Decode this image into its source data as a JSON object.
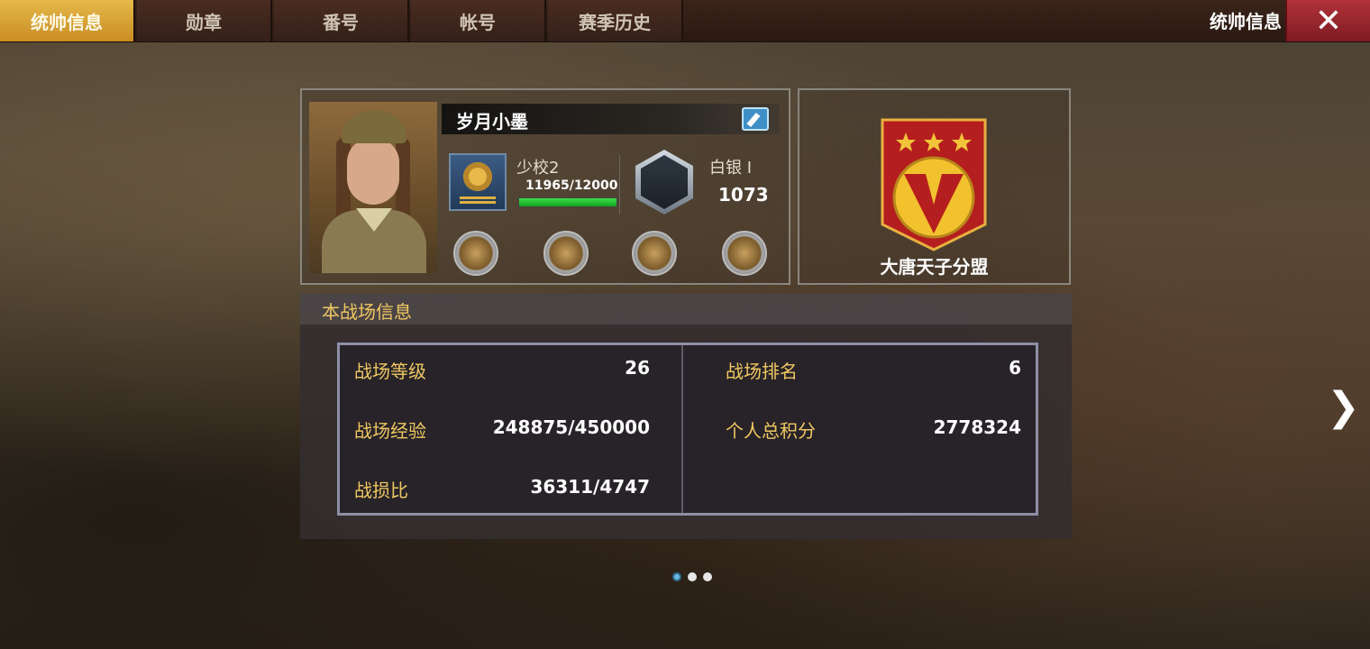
{
  "tabs": [
    {
      "label": "统帅信息",
      "active": true
    },
    {
      "label": "勋章",
      "active": false
    },
    {
      "label": "番号",
      "active": false
    },
    {
      "label": "帐号",
      "active": false
    },
    {
      "label": "赛季历史",
      "active": false
    }
  ],
  "header": {
    "title": "统帅信息",
    "close_icon": "close-icon"
  },
  "profile": {
    "name": "岁月小墨",
    "rank": "少校2",
    "exp": "11965/12000",
    "exp_fraction": 0.997,
    "league": "白银 I",
    "league_score": "1073",
    "medals": [
      "medal-1",
      "medal-2",
      "medal-3",
      "medal-4"
    ]
  },
  "alliance": {
    "name": "大唐天子分盟",
    "stars": 3
  },
  "battlefield": {
    "title": "本战场信息",
    "stats": [
      {
        "label": "战场等级",
        "value": "26"
      },
      {
        "label": "战场经验",
        "value": "248875/450000"
      },
      {
        "label": "战损比",
        "value": "36311/4747"
      },
      {
        "label": "战场排名",
        "value": "6"
      },
      {
        "label": "个人总积分",
        "value": "2778324"
      }
    ]
  },
  "pagination": {
    "pages": 3,
    "current": 1
  },
  "colors": {
    "tab_active": "#e6b84a",
    "close_button": "#9e2830",
    "stat_label": "#f0c862",
    "exp_bar": "#1fc82c"
  }
}
